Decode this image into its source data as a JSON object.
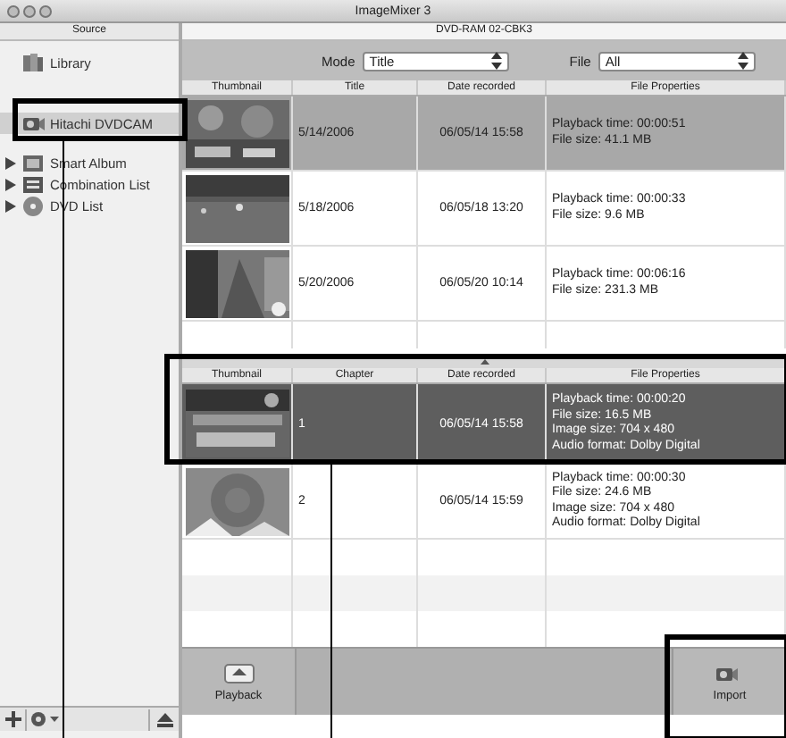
{
  "window": {
    "title": "ImageMixer 3"
  },
  "sidebar": {
    "header": "Source",
    "items": [
      {
        "label": "Library",
        "selected": false
      },
      {
        "label": "Hitachi DVDCAM",
        "selected": true
      },
      {
        "label": "Smart Album",
        "selected": false,
        "expanded": false
      },
      {
        "label": "Combination List",
        "selected": false,
        "expanded": false
      },
      {
        "label": "DVD List",
        "selected": false,
        "expanded": false
      }
    ]
  },
  "disc_label": "DVD-RAM 02-CBK3",
  "toolbar": {
    "mode_label": "Mode",
    "mode_value": "Title",
    "file_label": "File",
    "file_value": "All"
  },
  "titles_table": {
    "columns": [
      "Thumbnail",
      "Title",
      "Date recorded",
      "File Properties"
    ],
    "rows": [
      {
        "title": "5/14/2006",
        "date": "06/05/14 15:58",
        "properties": [
          "Playback time: 00:00:51",
          "File size: 41.1 MB"
        ],
        "selected": true
      },
      {
        "title": "5/18/2006",
        "date": "06/05/18 13:20",
        "properties": [
          "Playback time: 00:00:33",
          "File size: 9.6 MB"
        ],
        "selected": false
      },
      {
        "title": "5/20/2006",
        "date": "06/05/20 10:14",
        "properties": [
          "Playback time: 00:06:16",
          "File size: 231.3 MB"
        ],
        "selected": false
      }
    ]
  },
  "chapters_table": {
    "columns": [
      "Thumbnail",
      "Chapter",
      "Date recorded",
      "File Properties"
    ],
    "rows": [
      {
        "chapter": "1",
        "date": "06/05/14 15:58",
        "properties": [
          "Playback time: 00:00:20",
          "File size: 16.5 MB",
          "Image size: 704 x 480",
          "Audio format: Dolby Digital"
        ],
        "selected": true
      },
      {
        "chapter": "2",
        "date": "06/05/14 15:59",
        "properties": [
          "Playback time: 00:00:30",
          "File size: 24.6 MB",
          "Image size: 704 x 480",
          "Audio format: Dolby Digital"
        ],
        "selected": false
      }
    ]
  },
  "buttons": [
    {
      "label": "Playback"
    },
    {
      "label": "Import"
    }
  ]
}
